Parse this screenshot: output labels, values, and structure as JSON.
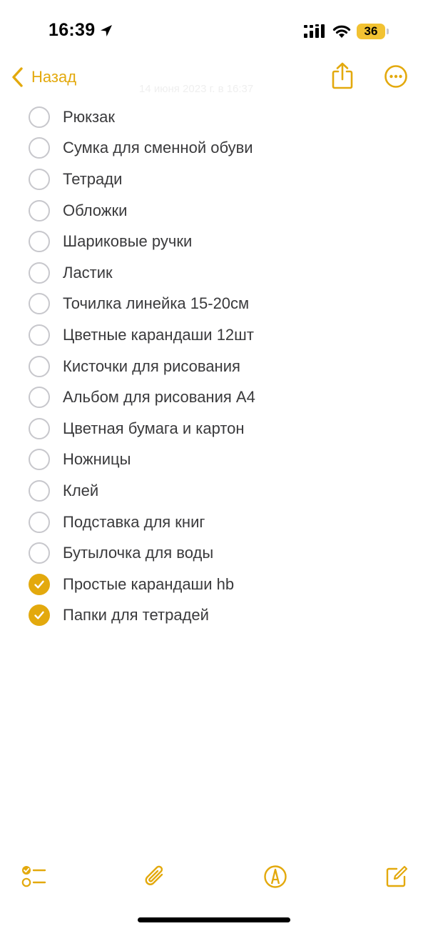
{
  "status_bar": {
    "time": "16:39",
    "battery": "36",
    "icons": [
      "location-arrow-icon",
      "cellular-signal-icon",
      "wifi-icon",
      "battery-icon"
    ]
  },
  "nav": {
    "back_label": "Назад",
    "faint_date": "14 июня 2023 г. в 16:37",
    "icons": [
      "chevron-left-icon",
      "share-icon",
      "more-icon"
    ]
  },
  "accent_color": "#e3a90d",
  "checklist": [
    {
      "label": "Рюкзак",
      "checked": false
    },
    {
      "label": "Сумка для сменной обуви",
      "checked": false
    },
    {
      "label": "Тетради",
      "checked": false
    },
    {
      "label": "Обложки",
      "checked": false
    },
    {
      "label": "Шариковые ручки",
      "checked": false
    },
    {
      "label": "Ластик",
      "checked": false
    },
    {
      "label": "Точилка линейка 15-20см",
      "checked": false
    },
    {
      "label": "Цветные карандаши 12шт",
      "checked": false
    },
    {
      "label": "Кисточки для рисования",
      "checked": false
    },
    {
      "label": "Альбом для рисования А4",
      "checked": false
    },
    {
      "label": "Цветная бумага и картон",
      "checked": false
    },
    {
      "label": "Ножницы",
      "checked": false
    },
    {
      "label": "Клей",
      "checked": false
    },
    {
      "label": "Подставка для книг",
      "checked": false
    },
    {
      "label": "Бутылочка для воды",
      "checked": false
    },
    {
      "label": "Простые карандаши hb",
      "checked": true
    },
    {
      "label": "Папки для тетрадей",
      "checked": true
    }
  ],
  "toolbar": {
    "icons": [
      "checklist-icon",
      "attachment-icon",
      "markup-icon",
      "compose-icon"
    ]
  }
}
